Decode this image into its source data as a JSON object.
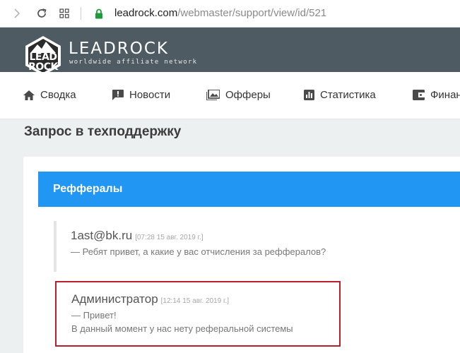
{
  "browser": {
    "url_domain": "leadrock.com",
    "url_path": "/webmaster/support/view/id/521"
  },
  "header": {
    "logo_text_top": "LEAD",
    "logo_text_bottom": "ROCK",
    "brand_name": "LEADROCK",
    "tagline": "worldwide affiliate network",
    "bg_color": "#4f5b62"
  },
  "menu": {
    "items": [
      {
        "label": "Сводка",
        "icon": "home-icon"
      },
      {
        "label": "Новости",
        "icon": "news-icon"
      },
      {
        "label": "Офферы",
        "icon": "offers-icon"
      },
      {
        "label": "Статистика",
        "icon": "statistics-icon"
      },
      {
        "label": "Финан",
        "icon": "finance-icon"
      }
    ]
  },
  "page": {
    "title": "Запрос в техподдержку"
  },
  "ticket": {
    "subject": "Реффералы",
    "header_color": "#2196f3",
    "messages": [
      {
        "author": "1ast@bk.ru",
        "time": "[07:28 15 авг. 2019 г.]",
        "lines": [
          "— Ребят привет, а какие у вас отчисления за реффералов?"
        ]
      },
      {
        "author": "Администратор",
        "time": "[12:14 15 авг. 2019 г.]",
        "lines": [
          "— Привет!",
          "В данный момент у нас нету реферальной системы"
        ],
        "highlight_color": "#b81f2a"
      }
    ]
  }
}
